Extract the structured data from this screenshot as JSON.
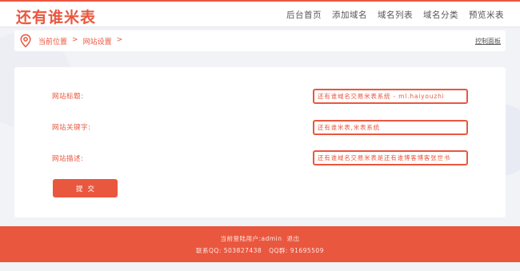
{
  "brand": {
    "logo_text": "还有谁米表",
    "accent": "#e9573f"
  },
  "nav": {
    "items": [
      {
        "label": "后台首页"
      },
      {
        "label": "添加域名"
      },
      {
        "label": "域名列表"
      },
      {
        "label": "域名分类"
      },
      {
        "label": "预览米表"
      }
    ]
  },
  "breadcrumb": {
    "icon": "map-pin-icon",
    "current": "当前位置",
    "page": "网站设置",
    "separator": ">",
    "panel_link": "控制面板"
  },
  "form": {
    "fields": [
      {
        "label": "网站标题:",
        "value": "还有谁域名交易米表系统 - ml.haiyouzhi"
      },
      {
        "label": "网站关键字:",
        "value": "还有谁米表,米表系统"
      },
      {
        "label": "网站描述:",
        "value": "还有谁域名交易米表是还有谁博客博客张世书"
      }
    ],
    "submit_label": "提交"
  },
  "footer": {
    "login_user": "当前登陆用户:admin",
    "logout": "退出",
    "contact_qq": "联系QQ: 503827438",
    "qq_group": "QQ群: 91695509"
  }
}
